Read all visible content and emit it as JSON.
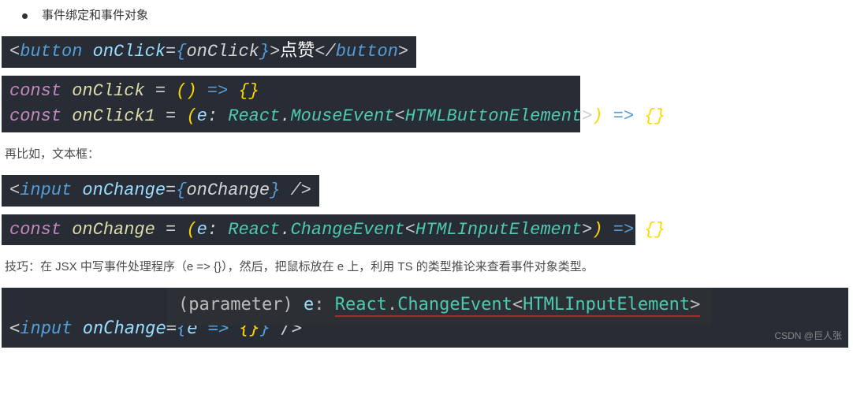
{
  "bullet": {
    "title": "事件绑定和事件对象"
  },
  "code1": {
    "lt1": "<",
    "tag1": "button",
    "sp": " ",
    "attr1": "onClick",
    "eq": "=",
    "lb": "{",
    "var1": "onClick",
    "rb": "}",
    "gt": ">",
    "text": "点赞",
    "lt2": "</",
    "tag2": "button",
    "gt2": ">"
  },
  "code2": {
    "kw": "const",
    "id1": "onClick",
    "eq": " = ",
    "lp": "(",
    "rp": ")",
    "arr": " => ",
    "lb": "{",
    "rb": "}",
    "id2": "onClick1",
    "param": "e",
    "colon": ": ",
    "ns": "React",
    "dot": ".",
    "evt": "MouseEvent",
    "la": "<",
    "elem": "HTMLButtonElement",
    "ra": ">"
  },
  "para1": "再比如，文本框：",
  "code3": {
    "lt": "<",
    "tag": "input",
    "sp": " ",
    "attr": "onChange",
    "eq": "=",
    "lb": "{",
    "var": "onChange",
    "rb": "}",
    "close": " />"
  },
  "code4": {
    "kw": "const",
    "id": "onChange",
    "eq": " = ",
    "lp": "(",
    "param": "e",
    "colon": ": ",
    "ns": "React",
    "dot": ".",
    "evt": "ChangeEvent",
    "la": "<",
    "elem": "HTMLInputElement",
    "ra": ">",
    "rp": ")",
    "arr": " => ",
    "lb": "{",
    "rb": "}"
  },
  "para2": "技巧：在 JSX 中写事件处理程序（e => {}），然后，把鼠标放在 e 上，利用 TS 的类型推论来查看事件对象类型。",
  "tooltip": {
    "label": "(parameter) ",
    "name": "e",
    "colon": ": ",
    "ns": "React",
    "dot": ".",
    "evt": "ChangeEvent",
    "la": "<",
    "elem": "HTMLInputElement",
    "ra": ">"
  },
  "code5": {
    "lt": "<",
    "tag": "input",
    "sp": " ",
    "attr": "onChange",
    "eq": "=",
    "lb": "{",
    "param": "e",
    "arr": " => ",
    "ilb": "{",
    "irb": "}",
    "rb": "}",
    "close": " />"
  },
  "watermark": "CSDN @巨人张"
}
